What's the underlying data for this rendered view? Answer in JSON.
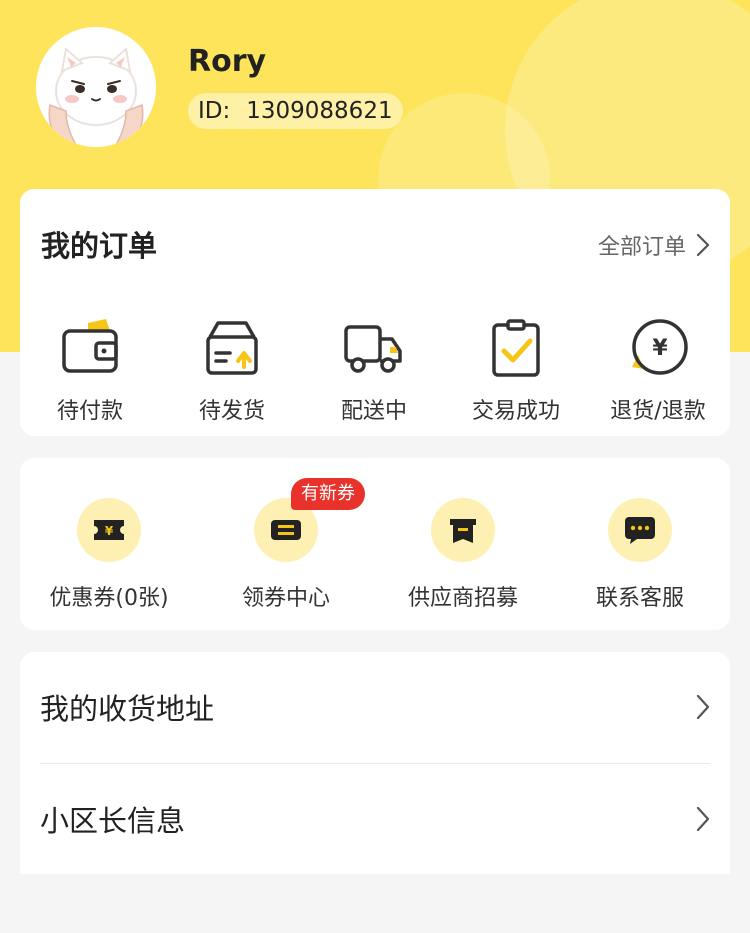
{
  "profile": {
    "name": "Rory",
    "id_label": "ID:",
    "id_value": "1309088621",
    "avatar": "cat-avatar-icon"
  },
  "orders": {
    "title": "我的订单",
    "all_label": "全部订单",
    "items": [
      {
        "label": "待付款",
        "icon": "wallet-icon"
      },
      {
        "label": "待发货",
        "icon": "package-icon"
      },
      {
        "label": "配送中",
        "icon": "truck-icon"
      },
      {
        "label": "交易成功",
        "icon": "clipboard-check-icon"
      },
      {
        "label": "退货/退款",
        "icon": "yen-coin-icon"
      }
    ]
  },
  "services": {
    "badge": "有新券",
    "items": [
      {
        "label": "优惠券(0张)",
        "icon": "coupon-icon"
      },
      {
        "label": "领券中心",
        "icon": "ticket-icon"
      },
      {
        "label": "供应商招募",
        "icon": "store-icon"
      },
      {
        "label": "联系客服",
        "icon": "chat-icon"
      }
    ]
  },
  "links": [
    {
      "label": "我的收货地址"
    },
    {
      "label": "小区长信息"
    }
  ],
  "colors": {
    "header_yellow": "#fde45a",
    "accent_yellow": "#f5c518",
    "icon_bubble": "#fdf0b2",
    "badge_red": "#e8322b",
    "page_bg": "#f5f5f5"
  }
}
